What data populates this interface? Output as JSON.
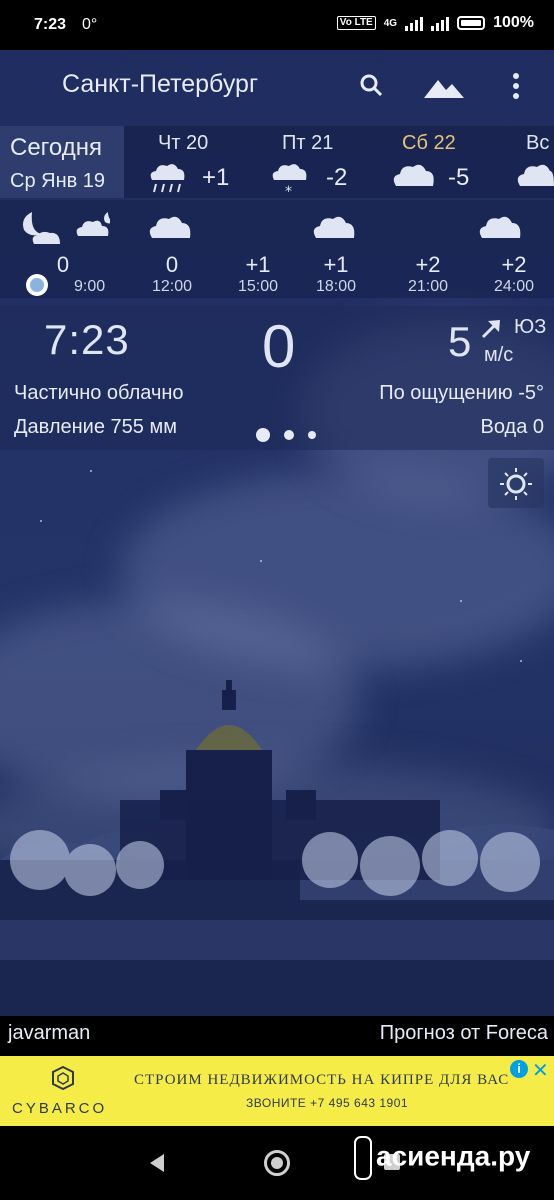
{
  "status_bar": {
    "time": "7:23",
    "temp_indicator": "0°",
    "volte_label": "Vo LTE",
    "network_label": "4G",
    "battery_percent": "100%"
  },
  "header": {
    "city": "Санкт-Петербург",
    "icons": [
      "search-icon",
      "landscape-icon",
      "more-vert-icon"
    ]
  },
  "days": {
    "today": {
      "label": "Сегодня",
      "date": "Ср Янв 19"
    },
    "items": [
      {
        "name": "Чт 20",
        "temp": "+1",
        "icon": "rain-icon"
      },
      {
        "name": "Пт 21",
        "temp": "-2",
        "icon": "snow-icon"
      },
      {
        "name": "Сб 22",
        "temp": "-5",
        "icon": "cloud-icon"
      },
      {
        "name": "Вс",
        "temp": "",
        "icon": "cloud-icon"
      }
    ]
  },
  "hourly": [
    {
      "temp": "0",
      "hour": "9:00",
      "icon": "moon-cloud-icon"
    },
    {
      "temp": "0",
      "hour": "12:00",
      "icon": "cloud-icon"
    },
    {
      "temp": "+1",
      "hour": "15:00",
      "icon": "cloud-icon"
    },
    {
      "temp": "+1",
      "hour": "18:00",
      "icon": "cloud-icon"
    },
    {
      "temp": "+2",
      "hour": "21:00",
      "icon": "cloud-icon"
    },
    {
      "temp": "+2",
      "hour": "24:00",
      "icon": "cloud-icon"
    }
  ],
  "current": {
    "time": "7:23",
    "temperature": "0",
    "wind_speed": "5",
    "wind_direction": "ЮЗ",
    "wind_unit": "м/с",
    "condition": "Частично облачно",
    "feels_like": "По ощущению -5°",
    "pressure": "Давление 755 мм",
    "water": "Вода 0"
  },
  "credits": {
    "author": "javarman",
    "source": "Прогноз от Foreca"
  },
  "ad": {
    "brand": "CYBARCO",
    "headline": "СТРОИМ НЕДВИЖИМОСТЬ НА КИПРЕ ДЛЯ ВАС",
    "phone": "ЗВОНИТЕ +7 495 643 1901",
    "info_label": "i",
    "close_label": "✕"
  },
  "watermark": "асиенда.ру",
  "colors": {
    "background": "#1f2c5e",
    "weekend_accent": "#e3c47a",
    "ad_background": "#f5ec48"
  }
}
